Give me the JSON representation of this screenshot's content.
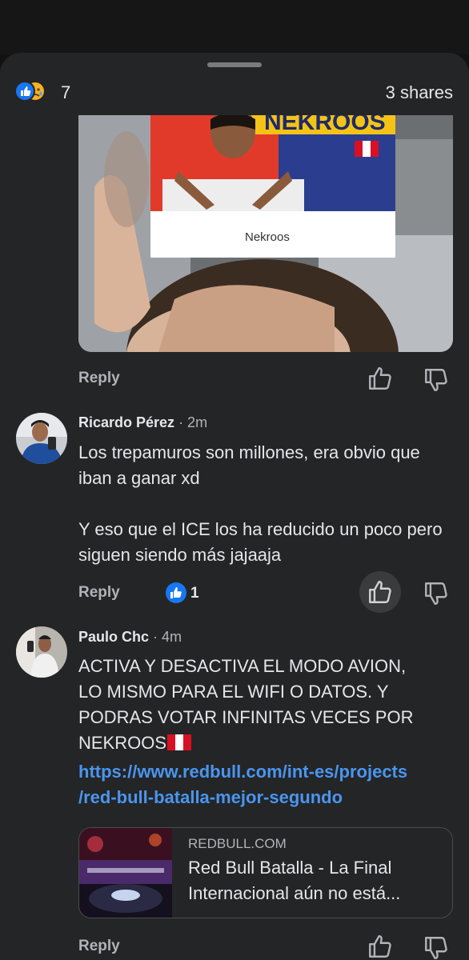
{
  "header": {
    "reaction_icons": [
      "like-icon",
      "sad-icon"
    ],
    "reaction_count": "7",
    "shares": "3 shares"
  },
  "photo": {
    "banner_text": "NEKROOS",
    "caption": "Nekroos"
  },
  "comments": [
    {
      "reply_label": "Reply"
    },
    {
      "author": "Ricardo Pérez",
      "time": " · 2m",
      "text_line1": "Los trepamuros son millones, era obvio que iban a ganar xd",
      "text_line2": "Y eso que el ICE los ha reducido un poco pero siguen siendo más jajaaja",
      "reply_label": "Reply",
      "like_count": "1"
    },
    {
      "author": "Paulo Chc",
      "time": " · 4m",
      "text": "ACTIVA Y DESACTIVA EL MODO AVION, LO MISMO PARA EL WIFI O DATOS. Y PODRAS VOTAR INFINITAS VECES POR NEKROOS",
      "link_line1": "https://www.redbull.com/int-es/projects",
      "link_line2": "/red-bull-batalla-mejor-segundo",
      "card": {
        "domain": "REDBULL.COM",
        "title": "Red Bull Batalla - La Final Internacional aún no está..."
      },
      "reply_label": "Reply"
    }
  ],
  "colors": {
    "sheet": "#242526",
    "link": "#4a95ef",
    "like_blue": "#1877f2"
  }
}
